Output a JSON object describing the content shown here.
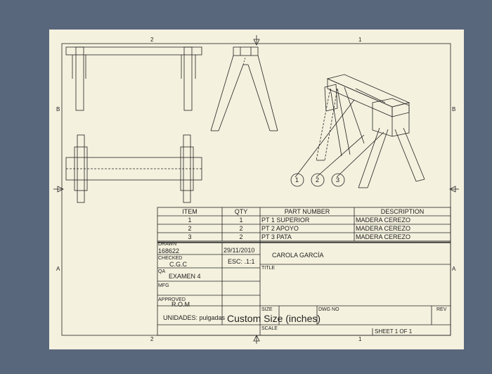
{
  "sheet": {
    "zone_numbers": {
      "col_left": "2",
      "col_right": "1"
    },
    "zone_letters": {
      "upper": "B",
      "lower": "A"
    }
  },
  "balloons": [
    "1",
    "2",
    "3"
  ],
  "parts_list": {
    "headers": [
      "ITEM",
      "QTY",
      "PART NUMBER",
      "DESCRIPTION"
    ],
    "rows": [
      [
        "1",
        "1",
        "PT 1 SUPERIOR",
        "MADERA CEREZO"
      ],
      [
        "2",
        "2",
        "PT 2 APOYO",
        "MADERA CEREZO"
      ],
      [
        "3",
        "2",
        "PT 3 PATA",
        "MADERA CEREZO"
      ]
    ]
  },
  "title_block": {
    "drawn_label": "DRAWN",
    "drawn_value": "168622",
    "drawn_date": "29/11/2010",
    "checked_label": "CHECKED",
    "checked_value": "C.G.C",
    "scale_note": "ESC: .1:1",
    "qa_label": "QA",
    "qa_value": "EXAMEN 4",
    "mfg_label": "MFG",
    "approved_label": "APPROVED",
    "approved_value": "R.O.M",
    "units": "UNIDADES: pulgadas",
    "company": "CAROLA GARCÍA",
    "title_label": "TITLE",
    "size_label": "SIZE",
    "size_value": "Custom Size (inches)",
    "dwg_label": "DWG NO",
    "rev_label": "REV",
    "scale_label": "SCALE",
    "sheet_text": "SHEET 1  OF 1"
  }
}
